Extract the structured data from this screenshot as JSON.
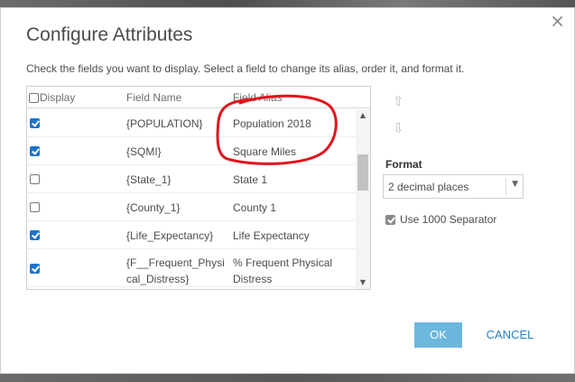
{
  "dialog": {
    "title": "Configure Attributes",
    "close_glyph": "×",
    "instructions": "Check the fields you want to display. Select a field to change its alias, order it, and format it."
  },
  "grid": {
    "headers": {
      "display": "Display",
      "field_name": "Field Name",
      "field_alias": "Field Alias"
    },
    "rows": [
      {
        "name": "{POPULATION}",
        "alias": "Population 2018",
        "checked": true
      },
      {
        "name": "{SQMI}",
        "alias": "Square Miles",
        "checked": true
      },
      {
        "name": "{State_1}",
        "alias": "State 1",
        "checked": false
      },
      {
        "name": "{County_1}",
        "alias": "County 1",
        "checked": false
      },
      {
        "name": "{Life_Expectancy}",
        "alias": "Life Expectancy",
        "checked": true
      },
      {
        "name": "{F__Frequent_Physi cal_Distress}",
        "alias": "% Frequent Physical Distress",
        "checked": true
      }
    ],
    "scroll_up_glyph": "▲",
    "scroll_down_glyph": "▼"
  },
  "order_controls": {
    "up_glyph": "⇧",
    "down_glyph": "⇩"
  },
  "format": {
    "label": "Format",
    "selected": "2 decimal places",
    "chevron_glyph": "▼",
    "use_separator_label": "Use 1000 Separator",
    "use_separator_checked": true
  },
  "buttons": {
    "ok": "OK",
    "cancel": "CANCEL"
  },
  "colors": {
    "checkbox_checked": "#1a73c8",
    "ok_button": "#6bb7dd",
    "cancel_text": "#2a7fbf",
    "annotation_circle": "#e0141e"
  },
  "icons": [
    "close-icon",
    "move-up-icon",
    "move-down-icon",
    "chevron-down-icon",
    "scroll-up-icon",
    "scroll-down-icon"
  ]
}
